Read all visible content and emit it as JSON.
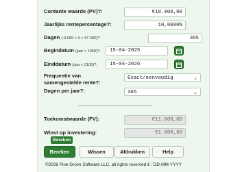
{
  "fields": {
    "present_value": {
      "label": "Contante waarde (PV)?:",
      "value": "€10.000,00"
    },
    "annual_rate": {
      "label": "Jaarlijks rentepercentage?:",
      "value": "10,0000%"
    },
    "days": {
      "label": "Dagen",
      "hint": "(-9.999 < # < 47.482)?:",
      "value": "365"
    },
    "start_date": {
      "label": "Begindatum",
      "hint": "(jaar > 1969)?:",
      "value": "15-04-2025"
    },
    "end_date": {
      "label": "Einddatum",
      "hint": "(jaar < 2100)?:",
      "value": "15-04-2026"
    },
    "compounding": {
      "label": "Frequentie van samengestelde rente?:",
      "value": "Exact/eenvoudig"
    },
    "days_per_year": {
      "label": "Dagen per jaar?:",
      "value": "365"
    },
    "future_value": {
      "label": "Toekomstwaarde (FV):",
      "value": "€11.000,00"
    },
    "profit": {
      "label": "Winst op investering:",
      "value": "€1.000,00"
    }
  },
  "buttons": {
    "calculate": "Bereken",
    "clear": "Wissen",
    "print": "Afdrukken",
    "help": "Help"
  },
  "tooltip": "Bereken",
  "footer": "©2026 Pine Grove Software LLC, all rights reserved € : DD-MM-YYYY",
  "colors": {
    "accent": "#2e7d32",
    "panel": "#eef7ee"
  }
}
